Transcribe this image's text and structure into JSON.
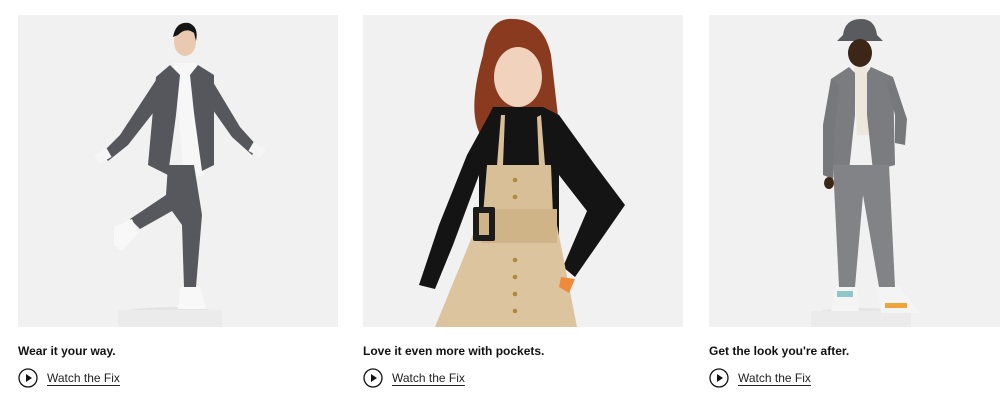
{
  "cards": [
    {
      "caption": "Wear it your way.",
      "link_label": "Watch the Fix",
      "play_icon": "play-circle-icon",
      "image": "woman in gray plaid suit with white heels on pedestal"
    },
    {
      "caption": "Love it even more with pockets.",
      "link_label": "Watch the Fix",
      "play_icon": "play-circle-icon",
      "image": "woman in tan belted pinafore dress over black turtleneck"
    },
    {
      "caption": "Get the look you're after.",
      "link_label": "Watch the Fix",
      "play_icon": "play-circle-icon",
      "image": "man in gray suit with bucket hat and sneakers"
    }
  ],
  "colors": {
    "photo_bg": "#f1f1f1",
    "text": "#111111",
    "suit_gray": "#5b5d63",
    "dress_tan": "#dcc49e",
    "turtleneck": "#111111"
  }
}
